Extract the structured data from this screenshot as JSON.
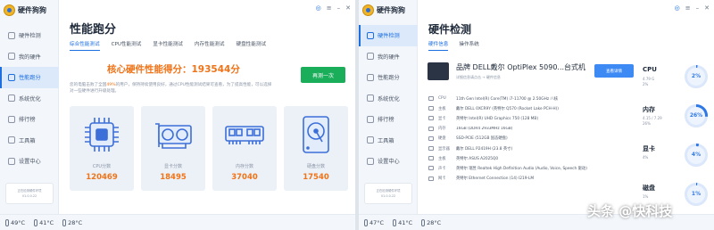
{
  "app": {
    "name": "硬件狗狗"
  },
  "nav": [
    "硬件检测",
    "我的硬件",
    "性能跑分",
    "系统优化",
    "排行榜",
    "工具箱",
    "设置中心"
  ],
  "statusbar": {
    "cpu_temp": "49°C",
    "gpu_temp": "41°C",
    "disk_temp": "28°C"
  },
  "statusbar_right": {
    "cpu_temp": "47°C",
    "gpu_temp": "41°C",
    "disk_temp": "28°C"
  },
  "side_card": {
    "line1": "正在检测硬件环境",
    "line2": "V1.0.0.22"
  },
  "left": {
    "title": "性能跑分",
    "tabs": [
      "综合性能测试",
      "CPU性能测试",
      "显卡性能测试",
      "内存性能测试",
      "硬盘性能测试"
    ],
    "score_text": "核心硬件性能得分：193544分",
    "desc_pre": "您的电脑击败了全国",
    "desc_pct": "49%",
    "desc_post": "的用户，保持持续使用良好，通过CPU性能测试结果可查看，为了提高性能，可以选择对一些硬件进行升级处理。",
    "retest_label": "再测一次",
    "cards": [
      {
        "label": "CPU分数",
        "value": "120469",
        "icon": "cpu-chip-icon"
      },
      {
        "label": "显卡分数",
        "value": "18495",
        "icon": "graphics-card-icon"
      },
      {
        "label": "内存分数",
        "value": "37040",
        "icon": "memory-stick-icon"
      },
      {
        "label": "硬盘分数",
        "value": "17540",
        "icon": "hard-disk-icon"
      }
    ]
  },
  "right": {
    "title": "硬件检测",
    "tabs": [
      "硬件信息",
      "操作系统"
    ],
    "device_name": "品牌 DELL戴尔 OptiPlex 5090...台式机",
    "device_sub": "详细信息请点击 → 硬件信息",
    "detail_btn": "查看详情",
    "hardware": [
      {
        "label": "CPU",
        "value": "11th Gen Intel(R) Core(TM) i7-11700 @ 2.50GHz 八核",
        "icon": "cpu-icon"
      },
      {
        "label": "主板",
        "value": "戴尔 DELL 0XCR9Y (英特尔 Q570 (Rocket Lake PCH-H))",
        "icon": "motherboard-icon"
      },
      {
        "label": "显卡",
        "value": "英特尔 Intel(R) UHD Graphics 750 (128 MB)",
        "icon": "gpu-icon"
      },
      {
        "label": "内存",
        "value": "16GB (DDR4 2933MHz 16GB)",
        "icon": "memory-icon"
      },
      {
        "label": "硬盘",
        "value": "SSD-PCIE (512GB 固态硬盘)",
        "icon": "disk-icon"
      },
      {
        "label": "显示器",
        "value": "戴尔 DELL P2419H (23.8 英寸)",
        "icon": "monitor-icon"
      },
      {
        "label": "主板",
        "value": "英特尔 ASUS A2025Q0",
        "icon": "board-icon"
      },
      {
        "label": "声卡",
        "value": "英特尔 瑞昱 Realtek High Definition Audio (Audio, Voice, Speech 驱动)",
        "icon": "sound-icon"
      },
      {
        "label": "网卡",
        "value": "英特尔 Ethernet Connection (14) I219-LM",
        "icon": "network-icon"
      }
    ],
    "usage": [
      {
        "name": "CPU",
        "sub1": "4.79 G",
        "sub2": "2%",
        "percent": 2
      },
      {
        "name": "内存",
        "sub1": "4.15 / 7.29",
        "sub2": "26%",
        "percent": 26
      },
      {
        "name": "显卡",
        "sub1": "4%",
        "sub2": "",
        "percent": 4
      },
      {
        "name": "磁盘",
        "sub1": "1%",
        "sub2": "",
        "percent": 1
      }
    ]
  },
  "watermark": "头条 @快科技",
  "colors": {
    "accent": "#1d6fe0",
    "score_orange": "#f07318",
    "retest_green": "#1aad5a",
    "ring_blue": "#2e78e6"
  }
}
